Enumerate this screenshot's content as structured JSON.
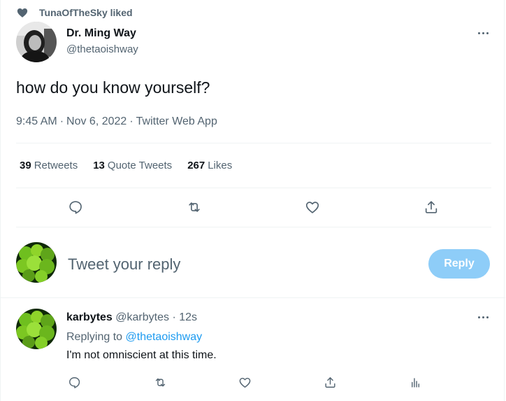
{
  "social_context": {
    "text": "TunaOfTheSky liked",
    "icon": "heart-icon"
  },
  "tweet": {
    "author_name": "Dr. Ming Way",
    "author_handle": "@thetaoishway",
    "text": "how do you know yourself?",
    "time": "9:45 AM",
    "date": "Nov 6, 2022",
    "source": "Twitter Web App",
    "separator": "·"
  },
  "stats": {
    "retweets_count": "39",
    "retweets_label": "Retweets",
    "quotes_count": "13",
    "quotes_label": "Quote Tweets",
    "likes_count": "267",
    "likes_label": "Likes"
  },
  "actions": [
    "reply-icon",
    "retweet-icon",
    "like-icon",
    "share-icon"
  ],
  "compose": {
    "placeholder": "Tweet your reply",
    "button_label": "Reply"
  },
  "reply": {
    "author_name": "karbytes",
    "author_handle": "@karbytes",
    "separator": "·",
    "time": "12s",
    "replying_prefix": "Replying to",
    "replying_to": "@thetaoishway",
    "text": "I'm not omniscient at this time."
  },
  "colors": {
    "accent": "#1d9bf0",
    "reply_button": "#8ecdf8",
    "muted": "#536471",
    "text": "#0f1419",
    "border": "#eff3f4"
  }
}
